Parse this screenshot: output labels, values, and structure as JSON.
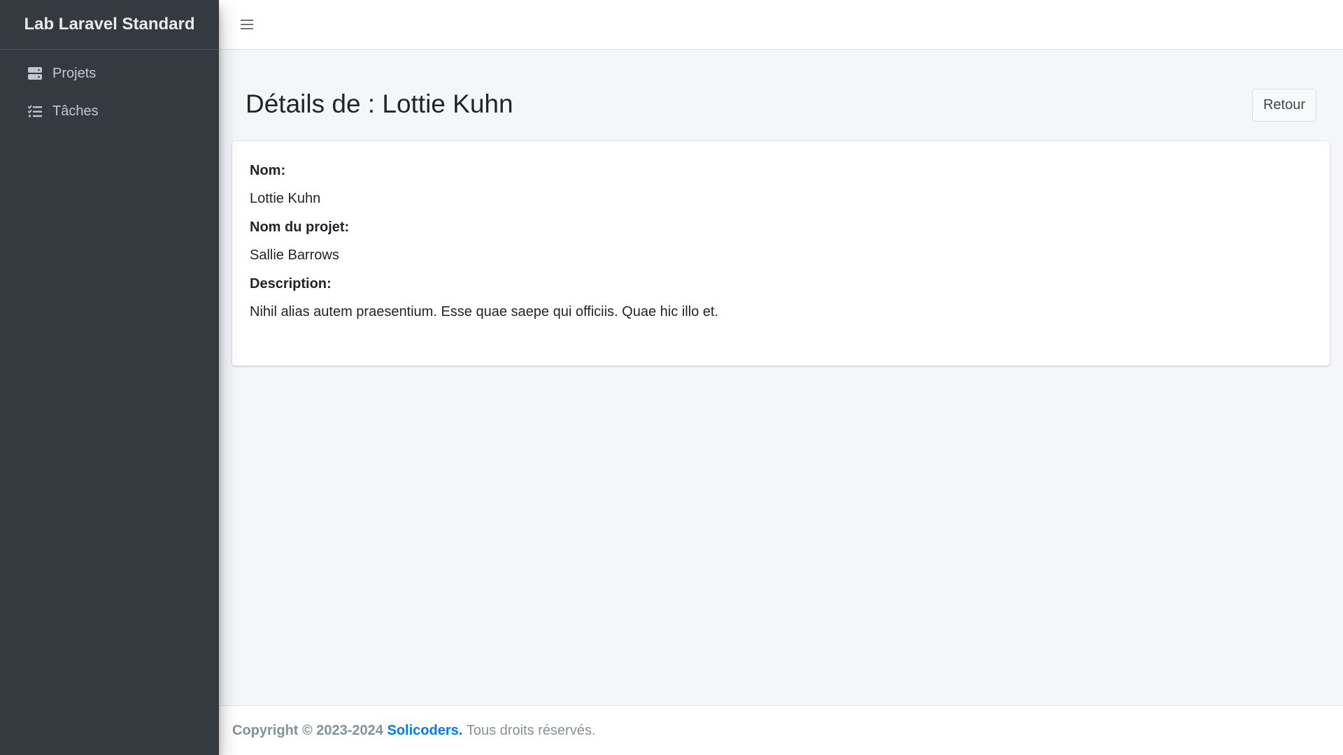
{
  "app": {
    "brand": "Lab Laravel Standard"
  },
  "sidebar": {
    "items": [
      {
        "label": "Projets",
        "icon": "server-icon"
      },
      {
        "label": "Tâches",
        "icon": "tasks-icon"
      }
    ]
  },
  "navbar": {
    "menu_icon": "hamburger-icon"
  },
  "page": {
    "title": "Détails de : Lottie Kuhn",
    "back_label": "Retour"
  },
  "details": {
    "name_label": "Nom:",
    "name_value": "Lottie Kuhn",
    "project_label": "Nom du projet:",
    "project_value": "Sallie Barrows",
    "description_label": "Description:",
    "description_value": "Nihil alias autem praesentium. Esse quae saepe qui officiis. Quae hic illo et."
  },
  "footer": {
    "copyright": "Copyright © 2023-2024",
    "company": "Solicoders.",
    "rights": "Tous droits réservés."
  },
  "colors": {
    "sidebar_bg": "#343a40",
    "content_bg": "#f4f6f9",
    "link": "#007bff"
  }
}
